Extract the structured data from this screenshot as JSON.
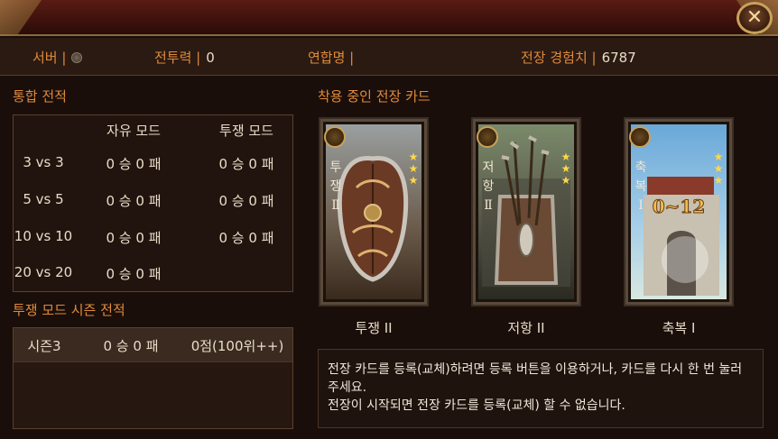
{
  "header": {
    "close_label": "✕"
  },
  "info": {
    "server_label": "서버 |",
    "power_label": "전투력 |",
    "power_value": "0",
    "alliance_label": "연합명 |",
    "exp_label": "전장 경험치 |",
    "exp_value": "6787"
  },
  "stats": {
    "title": "통합 전적",
    "columns": [
      "자유 모드",
      "투쟁 모드"
    ],
    "rows": [
      {
        "mode": "3 vs 3",
        "free": "0 승 0 패",
        "struggle": "0 승 0 패"
      },
      {
        "mode": "5 vs 5",
        "free": "0 승 0 패",
        "struggle": "0 승 0 패"
      },
      {
        "mode": "10 vs 10",
        "free": "0 승 0 패",
        "struggle": "0 승 0 패"
      },
      {
        "mode": "20 vs 20",
        "free": "0 승 0 패",
        "struggle": ""
      }
    ]
  },
  "season": {
    "title": "투쟁 모드 시즌 전적",
    "row": {
      "name": "시즌3",
      "record": "0 승 0 패",
      "score": "0점(100위++)"
    }
  },
  "cards": {
    "title": "착용 중인 전장 카드",
    "items": [
      {
        "name": "투쟁 II",
        "vertical_name": "투쟁Ⅱ",
        "stars": 3,
        "theme": "shield"
      },
      {
        "name": "저항 II",
        "vertical_name": "저항Ⅱ",
        "stars": 3,
        "theme": "arrows"
      },
      {
        "name": "축복 I",
        "vertical_name": "축복Ⅰ",
        "stars": 3,
        "theme": "gate",
        "art_text": "0~12"
      }
    ]
  },
  "notice": {
    "line1": "전장 카드를 등록(교체)하려면 등록 버튼을 이용하거나, 카드를 다시 한 번 눌러주세요.",
    "line2": "전장이 시작되면 전장 카드를 등록(교체) 할 수 없습니다."
  },
  "colors": {
    "accent": "#e08a3a",
    "text": "#e8dcc8",
    "star": "#ffd84a"
  }
}
